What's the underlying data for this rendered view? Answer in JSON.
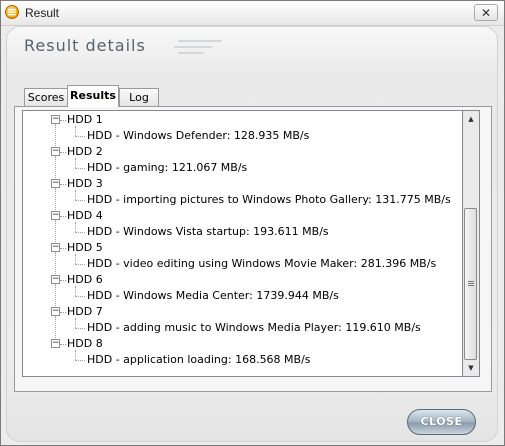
{
  "window": {
    "title": "Result",
    "close_glyph": "✕"
  },
  "header": {
    "title": "Result details"
  },
  "tabs": [
    {
      "label": "Scores",
      "active": false
    },
    {
      "label": "Results",
      "active": true
    },
    {
      "label": "Log",
      "active": false
    }
  ],
  "tree": {
    "expander_glyph": "−",
    "items": [
      {
        "label": "HDD 1",
        "child": "HDD - Windows Defender: 128.935 MB/s"
      },
      {
        "label": "HDD 2",
        "child": "HDD - gaming: 121.067 MB/s"
      },
      {
        "label": "HDD 3",
        "child": "HDD - importing pictures to Windows Photo Gallery: 131.775 MB/s"
      },
      {
        "label": "HDD 4",
        "child": "HDD - Windows Vista startup: 193.611 MB/s"
      },
      {
        "label": "HDD 5",
        "child": "HDD - video editing using Windows Movie Maker: 281.396 MB/s"
      },
      {
        "label": "HDD 6",
        "child": "HDD - Windows Media Center: 1739.944 MB/s"
      },
      {
        "label": "HDD 7",
        "child": "HDD - adding music to Windows Media Player: 119.610 MB/s"
      },
      {
        "label": "HDD 8",
        "child": "HDD - application loading: 168.568 MB/s"
      }
    ]
  },
  "scrollbar": {
    "up_glyph": "▲",
    "down_glyph": "▼"
  },
  "buttons": {
    "close_label": "CLOSE"
  },
  "colors": {
    "header_text": "#58626c",
    "close_button": "#9aaab8"
  }
}
